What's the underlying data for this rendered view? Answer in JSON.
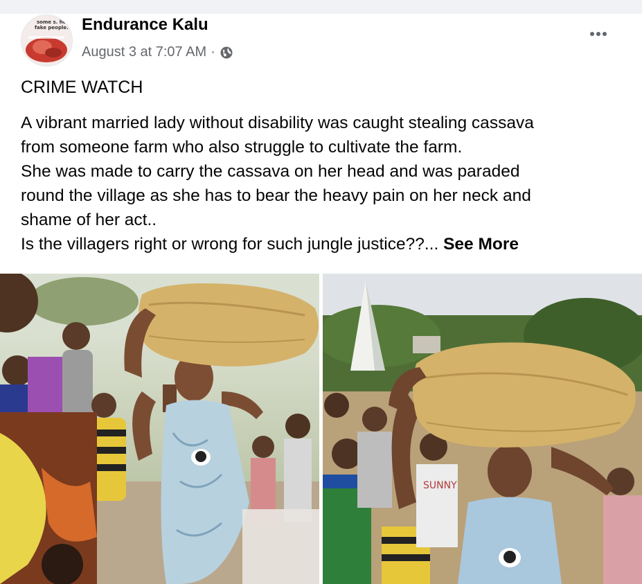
{
  "post": {
    "author": "Endurance Kalu",
    "timestamp": "August 3 at 7:07 AM",
    "separator": "·",
    "privacy_icon": "globe-icon",
    "menu_icon": "more-horizontal-icon",
    "avatar_text_line1": "some s. ho.",
    "avatar_text_line2": "fake people.",
    "title": "CRIME WATCH",
    "lines": [
      "A vibrant married lady without disability was caught stealing cassava",
      "from someone farm who also struggle to cultivate the farm.",
      "She was made to carry the cassava on her head and was paraded",
      "round the village as she has to bear the heavy pain on her neck and",
      "shame of her act..",
      "Is the villagers right or wrong for such jungle justice??..."
    ],
    "see_more": "See More"
  },
  "photos": {
    "left": {
      "shirt_print": ""
    },
    "right": {
      "shirt_text": "SUNNY"
    }
  },
  "colors": {
    "text_primary": "#050505",
    "text_secondary": "#65676b",
    "page_bg": "#f0f2f5",
    "sack": "#d4b26a"
  }
}
